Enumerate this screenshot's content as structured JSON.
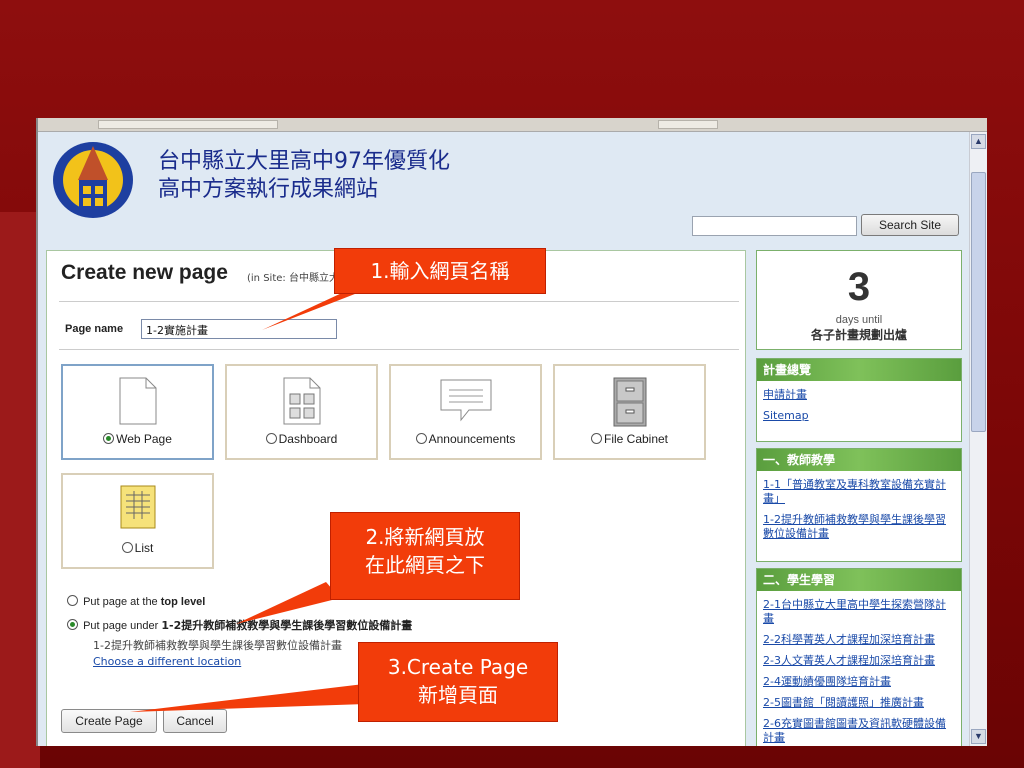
{
  "site": {
    "title_line1": "台中縣立大里高中97年優質化",
    "title_line2": "高中方案執行成果網站",
    "search_button": "Search Site"
  },
  "create": {
    "heading": "Create new page",
    "heading_sub": "(in Site: 台中縣立大里高中97年優質化高中方案執行成果網站)",
    "page_name_label": "Page name",
    "page_name_value": "1-2實施計畫",
    "templates": [
      {
        "label": "Web Page",
        "selected": true
      },
      {
        "label": "Dashboard",
        "selected": false
      },
      {
        "label": "Announcements",
        "selected": false
      },
      {
        "label": "File Cabinet",
        "selected": false
      },
      {
        "label": "List",
        "selected": false
      }
    ],
    "option_top": "Put page at the ",
    "option_top_bold": "top level",
    "option_under": "Put page under ",
    "option_under_bold": "1-2提升教師補救教學與學生課後學習數位設備計畫",
    "location_path": "1-2提升教師補救教學與學生課後學習數位設備計畫",
    "choose_location": "Choose a different location",
    "create_button": "Create Page",
    "cancel_button": "Cancel"
  },
  "sidebar": {
    "countdown_number": "3",
    "countdown_unit": "days until",
    "countdown_event": "各子計畫規劃出爐",
    "boxes": [
      {
        "title": "計畫總覽",
        "links": [
          "申請計畫",
          "Sitemap"
        ]
      },
      {
        "title": "一、教師教學",
        "links": [
          "1-1「普通教室及專科教室設備充實計畫」",
          "1-2提升教師補救教學與學生課後學習數位設備計畫"
        ]
      },
      {
        "title": "二、學生學習",
        "links": [
          "2-1台中縣立大里高中學生探索營隊計畫",
          "2-2科學菁英人才課程加深培育計畫",
          "2-3人文菁英人才課程加深培育計畫",
          "2-4運動績優團隊培育計畫",
          "2-5圖書館「閱讀護照」推廣計畫",
          "2-6充實圖書館圖書及資訊軟硬體設備計畫"
        ]
      }
    ]
  },
  "callouts": {
    "step1": "1.輸入網頁名稱",
    "step2_line1": "2.將新網頁放",
    "step2_line2": "在此網頁之下",
    "step3_line1": "3.Create Page",
    "step3_line2": "新增頁面"
  },
  "colors": {
    "slide_background": "#8e0e0e",
    "callout": "#f23c0a",
    "title_blue": "#1a2c8c",
    "sidebar_green": "#5a9e3e"
  }
}
